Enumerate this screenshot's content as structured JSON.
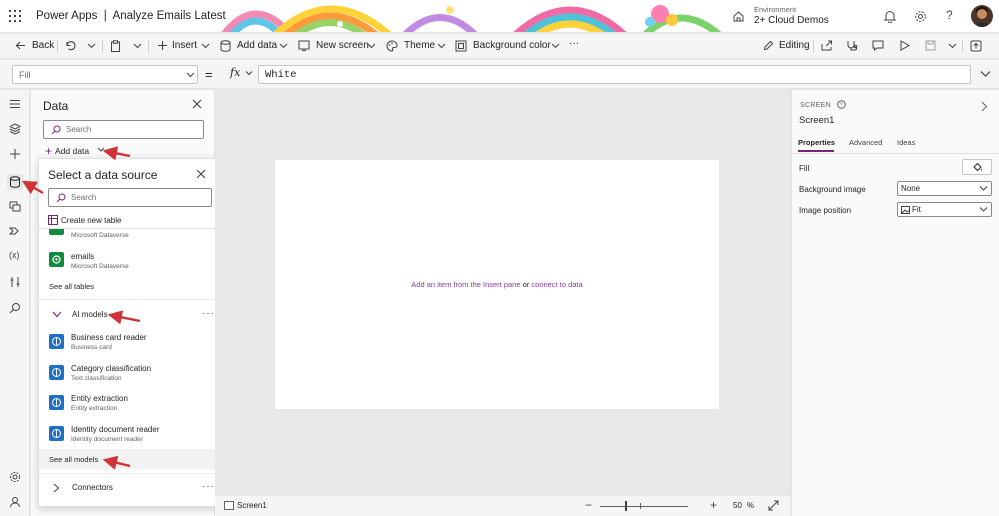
{
  "titlebar": {
    "app_name": "Power Apps",
    "separator": "|",
    "app_title": "Analyze Emails Latest",
    "environment_label": "Environment",
    "environment_name": "2+ Cloud Demos",
    "icons": [
      "waffle-icon",
      "environment-icon",
      "bell-icon",
      "gear-icon",
      "help-icon",
      "avatar"
    ]
  },
  "commandbar": {
    "back": "Back",
    "insert": "Insert",
    "add_data": "Add data",
    "new_screen": "New screen",
    "theme": "Theme",
    "background_color": "Background color",
    "more": "···",
    "editing": "Editing"
  },
  "formulabar": {
    "property": "Fill",
    "equals": "=",
    "fx": "fx",
    "formula": "White"
  },
  "datapane": {
    "title": "Data",
    "search_placeholder": "Search",
    "add_data": "Add data"
  },
  "flyout": {
    "title": "Select a data source",
    "search_placeholder": "Search",
    "create_table": "Create new table",
    "partial_item_sub": "Microsoft Dataverse",
    "emails_name": "emails",
    "emails_sub": "Microsoft Dataverse",
    "see_all_tables": "See all tables",
    "ai_section": "AI models",
    "ai_models": [
      {
        "name": "Business card reader",
        "sub": "Business card"
      },
      {
        "name": "Category classification",
        "sub": "Text classification"
      },
      {
        "name": "Entity extraction",
        "sub": "Entity extraction"
      },
      {
        "name": "Identity document reader",
        "sub": "Identity document reader"
      }
    ],
    "see_all_models": "See all models",
    "connectors_section": "Connectors",
    "more": "···"
  },
  "canvas": {
    "hint_insert": "Add an item from the Insert pane",
    "hint_or": "or",
    "hint_connect": "connect to data"
  },
  "statusbar": {
    "screen_name": "Screen1",
    "minus": "−",
    "plus": "+",
    "zoom": "50",
    "percent": "%"
  },
  "properties": {
    "type": "SCREEN",
    "name": "Screen1",
    "tabs": [
      "Properties",
      "Advanced",
      "Ideas"
    ],
    "fill_label": "Fill",
    "bg_image_label": "Background image",
    "bg_image_value": "None",
    "image_position_label": "Image position",
    "image_position_value": "Fit"
  },
  "colors": {
    "accent": "#742774",
    "dataverse_green": "#108a3e",
    "ai_blue": "#1f6fc5",
    "annotation_red": "#d13438"
  }
}
